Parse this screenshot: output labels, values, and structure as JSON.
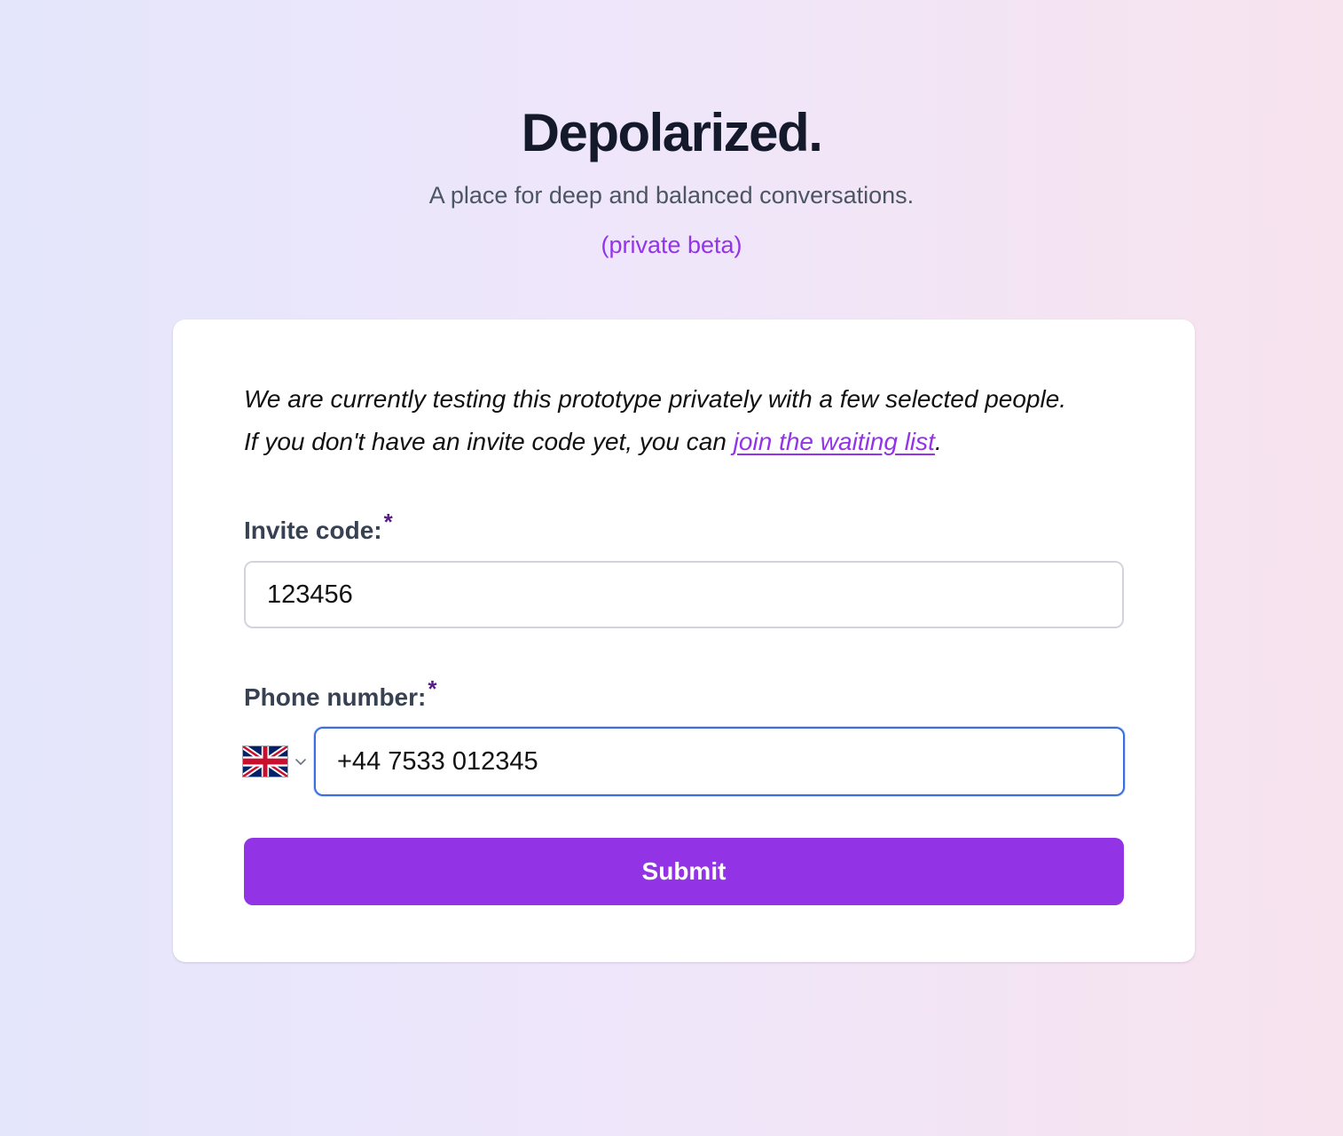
{
  "header": {
    "brand": "Depolarized.",
    "tagline": "A place for deep and balanced conversations.",
    "beta_label": "(private beta)"
  },
  "intro": {
    "line1": "We are currently testing this prototype privately with a few selected people.",
    "line2_prefix": "If you don't have an invite code yet, you can ",
    "waiting_list_link": "join the waiting list",
    "line2_suffix": "."
  },
  "form": {
    "invite": {
      "label": "Invite code:",
      "required_marker": "*",
      "value": "123456"
    },
    "phone": {
      "label": "Phone number:",
      "required_marker": "*",
      "country_icon": "uk-flag-icon",
      "value": "+44 7533 012345"
    },
    "submit_label": "Submit"
  },
  "colors": {
    "accent": "#9333ea",
    "focus_border": "#3b6fe0",
    "required_marker": "#581c87"
  }
}
